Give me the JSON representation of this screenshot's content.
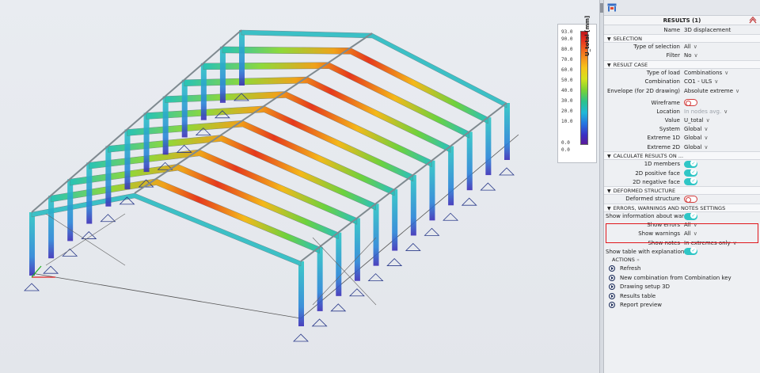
{
  "legend": {
    "unit": "U_total [mm]",
    "ticks": [
      "93.0",
      "90.0",
      "80.0",
      "70.0",
      "60.0",
      "50.0",
      "40.0",
      "30.0",
      "20.0",
      "10.0",
      "0.0",
      "0.0"
    ]
  },
  "panel": {
    "title": "RESULTS (1)",
    "name_label": "Name",
    "name_value": "3D displacement",
    "sections": {
      "selection": "SELECTION",
      "result_case": "RESULT CASE",
      "calculate": "CALCULATE RESULTS ON ...",
      "deformed": "DEFORMED STRUCTURE",
      "errors": "ERRORS, WARNINGS AND NOTES SETTINGS",
      "actions": "ACTIONS"
    },
    "selection": [
      {
        "label": "Type of selection",
        "value": "All"
      },
      {
        "label": "Filter",
        "value": "No"
      }
    ],
    "result_case": [
      {
        "label": "Type of load",
        "value": "Combinations"
      },
      {
        "label": "Combination",
        "value": "CO1 - ULS"
      },
      {
        "label": "Envelope (for 2D drawing)",
        "value": "Absolute extreme"
      }
    ],
    "wireframe_label": "Wireframe",
    "display": [
      {
        "label": "Location",
        "value": "In nodes avg."
      },
      {
        "label": "Value",
        "value": "U_total"
      },
      {
        "label": "System",
        "value": "Global"
      },
      {
        "label": "Extreme 1D",
        "value": "Global"
      },
      {
        "label": "Extreme 2D",
        "value": "Global"
      }
    ],
    "calculate": [
      {
        "label": "1D members"
      },
      {
        "label": "2D positive face"
      },
      {
        "label": "2D negative face"
      }
    ],
    "deformed_label": "Deformed structure",
    "errors": {
      "show_info_label": "Show information about war...",
      "show_errors_label": "Show errors",
      "show_errors_value": "All",
      "show_warnings_label": "Show warnings",
      "show_warnings_value": "All",
      "show_notes_label": "Show notes",
      "show_notes_value": "In extremes only",
      "show_table_label": "Show table with explanation ..."
    },
    "actions": [
      "Refresh",
      "New combination from Combination key",
      "Drawing setup 3D",
      "Results table",
      "Report preview"
    ]
  }
}
